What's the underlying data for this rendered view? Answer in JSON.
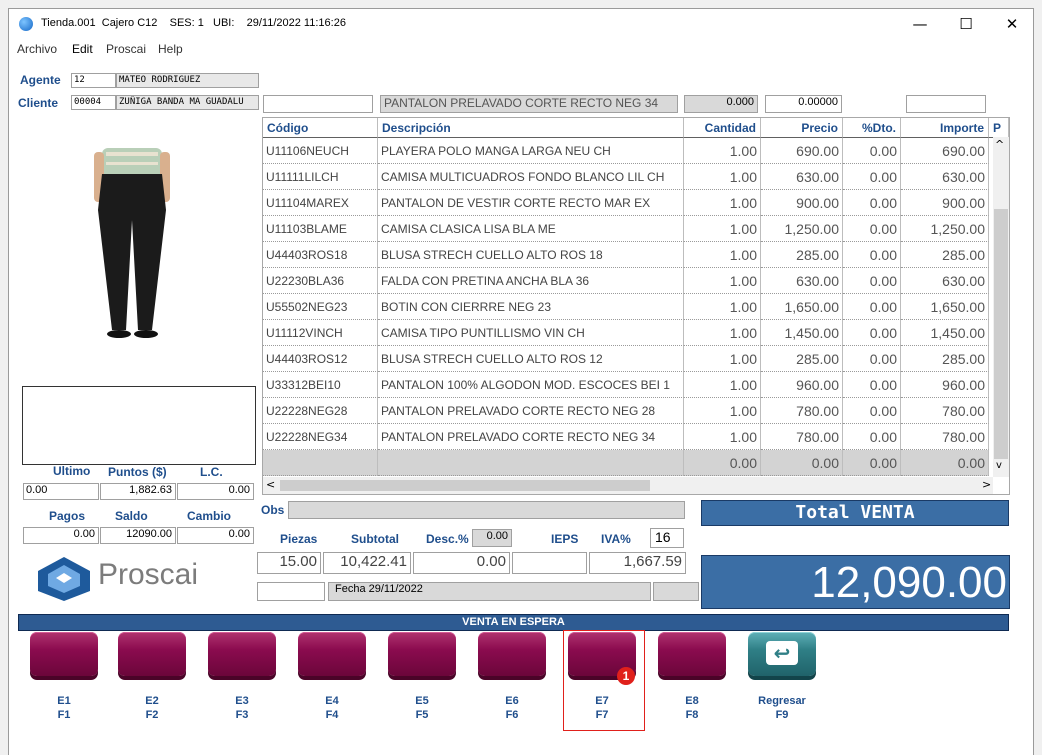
{
  "window": {
    "title": "Tienda.001  Cajero C12    SES: 1   UBI:    29/11/2022 11:16:26",
    "minimize_glyph": "—",
    "maximize_glyph": "☐",
    "close_glyph": "✕"
  },
  "menu": [
    "Archivo",
    "Edit",
    "Proscai",
    "Help"
  ],
  "agente": {
    "label": "Agente",
    "code": "12",
    "name": "MATEO RODRIGUEZ"
  },
  "cliente": {
    "label": "Cliente",
    "code": "00004",
    "name": "ZUÑIGA BANDA MA GUADALU"
  },
  "entry": {
    "code": "",
    "description": "PANTALON PRELAVADO CORTE RECTO NEG 34",
    "qty": "0.000",
    "price": "0.00000",
    "extra": ""
  },
  "grid": {
    "headers": [
      "Código",
      "Descripción",
      "Cantidad",
      "Precio",
      "%Dto.",
      "Importe",
      "P"
    ],
    "rows": [
      [
        "U11106NEUCH",
        "PLAYERA POLO MANGA LARGA NEU CH",
        "1.00",
        "690.00",
        "0.00",
        "690.00"
      ],
      [
        "U11111LILCH",
        "CAMISA MULTICUADROS FONDO BLANCO LIL CH",
        "1.00",
        "630.00",
        "0.00",
        "630.00"
      ],
      [
        "U11104MAREX",
        "PANTALON DE VESTIR CORTE RECTO MAR EX",
        "1.00",
        "900.00",
        "0.00",
        "900.00"
      ],
      [
        "U11103BLAME",
        "CAMISA CLASICA LISA BLA ME",
        "1.00",
        "1,250.00",
        "0.00",
        "1,250.00"
      ],
      [
        "U44403ROS18",
        "BLUSA STRECH CUELLO ALTO ROS 18",
        "1.00",
        "285.00",
        "0.00",
        "285.00"
      ],
      [
        "U22230BLA36",
        "FALDA CON PRETINA ANCHA BLA 36",
        "1.00",
        "630.00",
        "0.00",
        "630.00"
      ],
      [
        "U55502NEG23",
        "BOTIN  CON CIERRRE NEG 23",
        "1.00",
        "1,650.00",
        "0.00",
        "1,650.00"
      ],
      [
        "U11112VINCH",
        "CAMISA  TIPO PUNTILLISMO VIN CH",
        "1.00",
        "1,450.00",
        "0.00",
        "1,450.00"
      ],
      [
        "U44403ROS12",
        "BLUSA STRECH CUELLO ALTO ROS 12",
        "1.00",
        "285.00",
        "0.00",
        "285.00"
      ],
      [
        "U33312BEI10",
        "PANTALON 100%  ALGODON MOD. ESCOCES BEI 1",
        "1.00",
        "960.00",
        "0.00",
        "960.00"
      ],
      [
        "U22228NEG28",
        "PANTALON PRELAVADO CORTE RECTO NEG 28",
        "1.00",
        "780.00",
        "0.00",
        "780.00"
      ],
      [
        "U22228NEG34",
        "PANTALON PRELAVADO CORTE RECTO NEG 34",
        "1.00",
        "780.00",
        "0.00",
        "780.00"
      ]
    ],
    "blank_row": [
      "",
      "",
      "0.00",
      "0.00",
      "0.00",
      "0.00"
    ]
  },
  "scroll": {
    "up": "^",
    "down": "v",
    "left": "<",
    "right": ">"
  },
  "ultimo": {
    "label": "Ultimo",
    "value": "0.00"
  },
  "puntos": {
    "label": "Puntos ($)",
    "value": "1,882.63"
  },
  "lc": {
    "label": "L.C.",
    "value": "0.00"
  },
  "pagos": {
    "label": "Pagos",
    "value": "0.00"
  },
  "saldo": {
    "label": "Saldo",
    "value": "12090.00"
  },
  "cambio": {
    "label": "Cambio",
    "value": "0.00"
  },
  "obs": {
    "label": "Obs",
    "value": ""
  },
  "totals": {
    "piezas_label": "Piezas",
    "piezas": "15.00",
    "subtotal_label": "Subtotal",
    "subtotal": "10,422.41",
    "desc_label": "Desc.%",
    "desc_pct": "0.00",
    "desc": "0.00",
    "ieps_label": "IEPS",
    "ieps": "",
    "iva_label": "IVA%",
    "iva_pct": "16",
    "iva": "1,667.59"
  },
  "total_venta": {
    "label": "Total VENTA",
    "value": "12,090.00"
  },
  "fecha": "Fecha 29/11/2022",
  "brand": "Proscai",
  "status_bar": "VENTA EN ESPERA",
  "fkeys": [
    {
      "top": "E1",
      "bottom": "F1"
    },
    {
      "top": "E2",
      "bottom": "F2"
    },
    {
      "top": "E3",
      "bottom": "F3"
    },
    {
      "top": "E4",
      "bottom": "F4"
    },
    {
      "top": "E5",
      "bottom": "F5"
    },
    {
      "top": "E6",
      "bottom": "F6"
    },
    {
      "top": "E7",
      "bottom": "F7"
    },
    {
      "top": "E8",
      "bottom": "F8"
    },
    {
      "top": "Regresar",
      "bottom": "F9"
    }
  ],
  "highlight_badge": "1",
  "colors": {
    "accent": "#1f4e8c",
    "button": "#8b0b4f",
    "total_panel": "#3b6ea5",
    "badge": "#e0201b"
  }
}
